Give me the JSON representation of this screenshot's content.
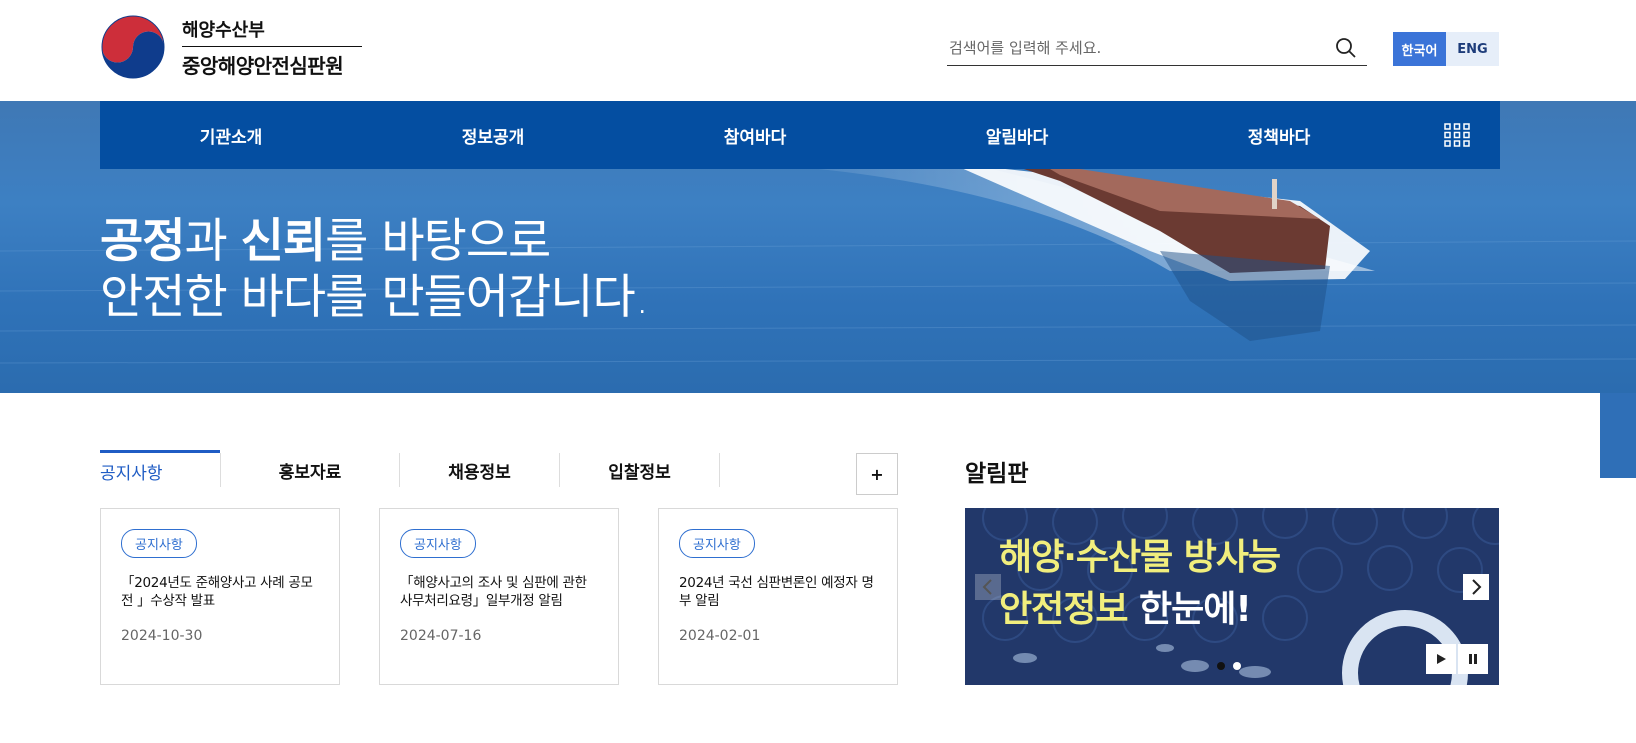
{
  "header": {
    "ministry": "해양수산부",
    "org_name": "중앙해양안전심판원",
    "search_placeholder": "검색어를 입력해 주세요.",
    "lang_ko": "한국어",
    "lang_en": "ENG"
  },
  "nav": {
    "items": [
      "기관소개",
      "정보공개",
      "참여바다",
      "알림바다",
      "정책바다"
    ]
  },
  "hero": {
    "line1_bold1": "공정",
    "line1_mid": "과 ",
    "line1_bold2": "신뢰",
    "line1_end": "를 바탕으로",
    "line2": "안전한 바다를 만들어갑니다."
  },
  "tabs": {
    "items": [
      "공지사항",
      "홍보자료",
      "채용정보",
      "입찰정보"
    ],
    "active": "공지사항",
    "more_label": "+"
  },
  "cards": [
    {
      "badge": "공지사항",
      "title": "「2024년도 준해양사고 사례 공모전 」수상작 발표",
      "date": "2024-10-30"
    },
    {
      "badge": "공지사항",
      "title": "「해양사고의 조사 및 심판에 관한 사무처리요령」일부개정 알림",
      "date": "2024-07-16"
    },
    {
      "badge": "공지사항",
      "title": "2024년 국선 심판변론인 예정자 명부 알림",
      "date": "2024-02-01"
    }
  ],
  "board": {
    "title": "알림판",
    "slide_line1": "해양·수산물 방사능",
    "slide_line2_a": "안전정보",
    "slide_line2_b": " 한눈에!"
  },
  "colors": {
    "nav_bg": "#044ea1",
    "accent": "#1f5cc4",
    "lang_active": "#3b74d8",
    "board_bg": "#22386a",
    "slide_highlight": "#f1ee7d"
  }
}
